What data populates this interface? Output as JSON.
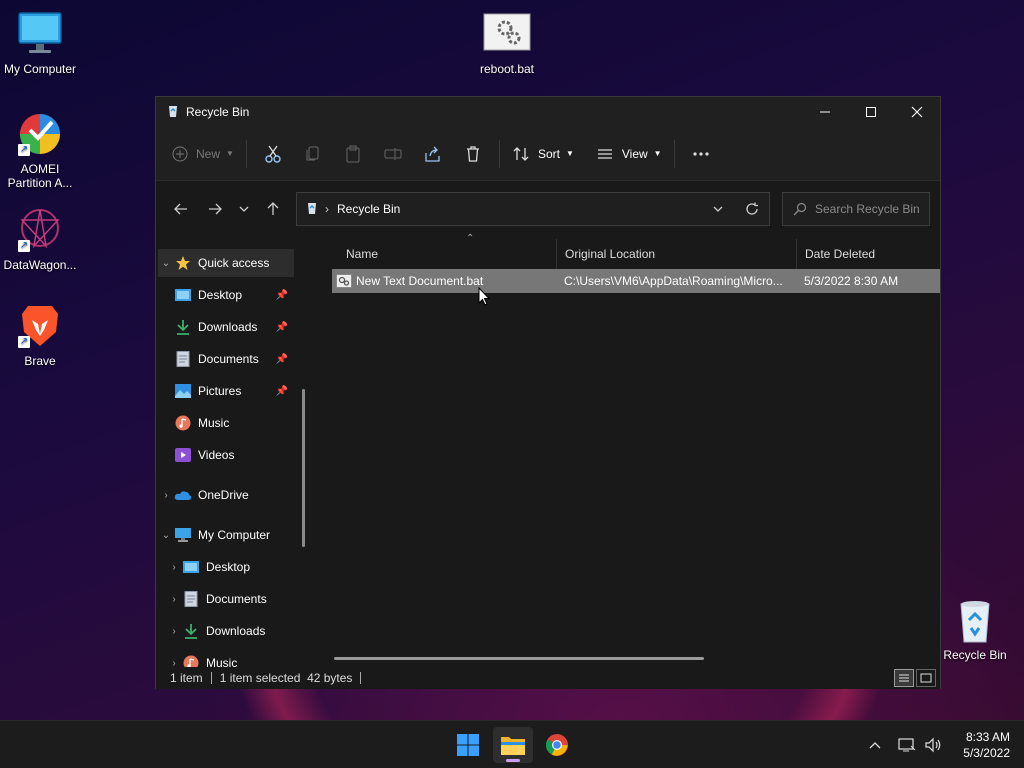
{
  "desktop": {
    "icons": [
      {
        "label": "My Computer"
      },
      {
        "label": "reboot.bat"
      },
      {
        "label": "AOMEI Partition A..."
      },
      {
        "label": "DataWagon..."
      },
      {
        "label": "Brave"
      },
      {
        "label": "Recycle Bin"
      }
    ]
  },
  "window": {
    "title": "Recycle Bin",
    "toolbar": {
      "new_label": "New",
      "sort_label": "Sort",
      "view_label": "View"
    },
    "address": {
      "path": "Recycle Bin"
    },
    "search": {
      "placeholder": "Search Recycle Bin"
    },
    "sidebar": {
      "quick_access": "Quick access",
      "items": [
        {
          "label": "Desktop"
        },
        {
          "label": "Downloads"
        },
        {
          "label": "Documents"
        },
        {
          "label": "Pictures"
        },
        {
          "label": "Music"
        },
        {
          "label": "Videos"
        }
      ],
      "onedrive": "OneDrive",
      "my_computer": "My Computer",
      "computer_items": [
        {
          "label": "Desktop"
        },
        {
          "label": "Documents"
        },
        {
          "label": "Downloads"
        },
        {
          "label": "Music"
        }
      ]
    },
    "columns": [
      "Name",
      "Original Location",
      "Date Deleted"
    ],
    "files": [
      {
        "name": "New Text Document.bat",
        "original_location": "C:\\Users\\VM6\\AppData\\Roaming\\Micro...",
        "date_deleted": "5/3/2022 8:30 AM"
      }
    ],
    "status": {
      "count": "1 item",
      "selection": "1 item selected  42 bytes"
    }
  },
  "taskbar": {
    "time": "8:33 AM",
    "date": "5/3/2022"
  }
}
